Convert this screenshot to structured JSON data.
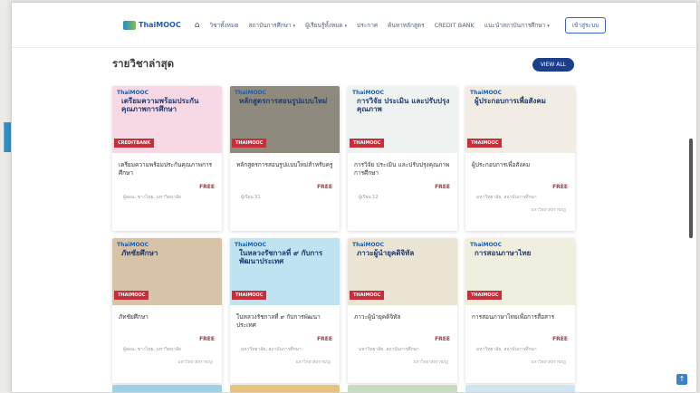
{
  "background": {
    "fragment": "rAll"
  },
  "nav": {
    "logo": "ThaiMOOC",
    "items": [
      "วิชาทั้งหมด",
      "สถาบันการศึกษา",
      "ผู้เรียนรู้ทั้งหมด",
      "ประกาศ",
      "ค้นหาหลักสูตร",
      "CREDIT BANK",
      "แนะนำสถาบันการศึกษา"
    ],
    "login": "เข้าสู่ระบบ"
  },
  "section": {
    "title": "รายวิชาล่าสุด",
    "view_all": "VIEW ALL"
  },
  "cards": [
    {
      "badge": "CREDITBANK",
      "thumb_title": "เตรียมความพร้อมประกันคุณภาพการศึกษา",
      "title": "เตรียมความพร้อมประกันคุณภาพการศึกษา",
      "price": "FREE",
      "meta": "ผู้สอน: ชาวไทย, มหาวิทยาลัย",
      "meta2": "",
      "bg": "#f6d9e4"
    },
    {
      "badge": "THAIMOOC",
      "thumb_title": "หลักสูตรการสอนรูปแบบใหม่",
      "title": "หลักสูตรการสอนรูปแบบใหม่สำหรับครู",
      "price": "FREE",
      "meta": "ผู้เรียน 31",
      "meta2": "",
      "bg": "#8e8a7d"
    },
    {
      "badge": "THAIMOOC",
      "thumb_title": "การวิจัย ประเมิน และปรับปรุงคุณภาพ",
      "title": "การวิจัย ประเมิน และปรับปรุงคุณภาพการศึกษา",
      "price": "FREE",
      "meta": "ผู้เรียน 12",
      "meta2": "",
      "bg": "#eef3f1"
    },
    {
      "badge": "THAIMOOC",
      "thumb_title": "ผู้ประกอบการเพื่อสังคม",
      "title": "ผู้ประกอบการเพื่อสังคม",
      "price": "FREE",
      "meta": "มหาวิทยาลัย, สถาบันการศึกษา",
      "meta2": "มหาวิทยาลัยราชภัฏ",
      "bg": "#f1ece4"
    },
    {
      "badge": "THAIMOOC",
      "thumb_title": "ภัทชัยศึกษา",
      "title": "ภัทชัยศึกษา",
      "price": "FREE",
      "meta": "ผู้สอน: ชาวไทย, มหาวิทยาลัย",
      "meta2": "มหาวิทยาลัยราชภัฏ",
      "bg": "#d7c4a8"
    },
    {
      "badge": "THAIMOOC",
      "thumb_title": "ในหลวงรัชกาลที่ ๙ กับการพัฒนาประเทศ",
      "title": "ในหลวงรัชกาลที่ ๙ กับการพัฒนาประเทศ",
      "price": "FREE",
      "meta": "มหาวิทยาลัย, สถาบันการศึกษา",
      "meta2": "มหาวิทยาลัยราชภัฏ",
      "bg": "#bfe3f0"
    },
    {
      "badge": "THAIMOOC",
      "thumb_title": "ภาวะผู้นำยุคดิจิทัล",
      "title": "ภาวะผู้นำยุคดิจิทัล",
      "price": "FREE",
      "meta": "มหาวิทยาลัย, สถาบันการศึกษา",
      "meta2": "มหาวิทยาลัยราชภัฏ",
      "bg": "#e9e4d4"
    },
    {
      "badge": "THAIMOOC",
      "thumb_title": "การสอนภาษาไทย",
      "title": "การสอนภาษาไทยเพื่อการสื่อสาร",
      "price": "FREE",
      "meta": "มหาวิทยาลัย, สถาบันการศึกษา",
      "meta2": "มหาวิทยาลัยราชภัฏ",
      "bg": "#f0eedf"
    }
  ],
  "row3_colors": [
    "#9fd0e6",
    "#e6c27a",
    "#c7dcc0",
    "#cfe5f0"
  ]
}
